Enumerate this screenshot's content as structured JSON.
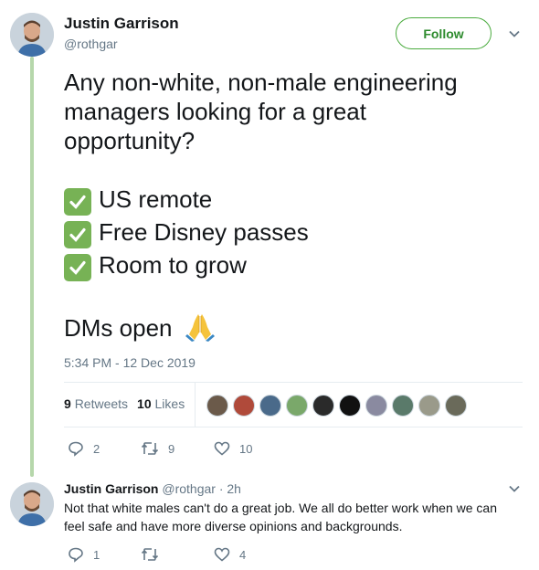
{
  "tweet": {
    "author_name": "Justin Garrison",
    "author_handle": "@rothgar",
    "follow_label": "Follow",
    "text_lines": [
      "Any non-white, non-male engineering",
      "managers looking for a great",
      "opportunity?"
    ],
    "checklist": [
      "US remote",
      "Free Disney passes",
      "Room to grow"
    ],
    "closing": "DMs open",
    "timestamp": "5:34 PM - 12 Dec 2019",
    "retweets_count": "9",
    "retweets_label": "Retweets",
    "likes_count": "10",
    "likes_label": "Likes",
    "reply_count": "2",
    "retweet_count_action": "9",
    "like_count_action": "10",
    "liker_colors": [
      "#6b5a4a",
      "#b04a3a",
      "#4a6a8a",
      "#7aa86a",
      "#2a2a2a",
      "#111111",
      "#8a8aa0",
      "#5a7a6a",
      "#9a9a8a",
      "#6a6a5a"
    ]
  },
  "reply": {
    "author_name": "Justin Garrison",
    "author_handle": "@rothgar",
    "age": "· 2h",
    "text": "Not that white males can't do a great job. We all do better work when we can feel safe and have more diverse opinions and backgrounds.",
    "reply_count": "1",
    "like_count": "4"
  },
  "colors": {
    "thread_line": "#b6d7ab",
    "follow_border": "#4aab3e",
    "check_green": "#77b255",
    "meta_gray": "#657786"
  }
}
